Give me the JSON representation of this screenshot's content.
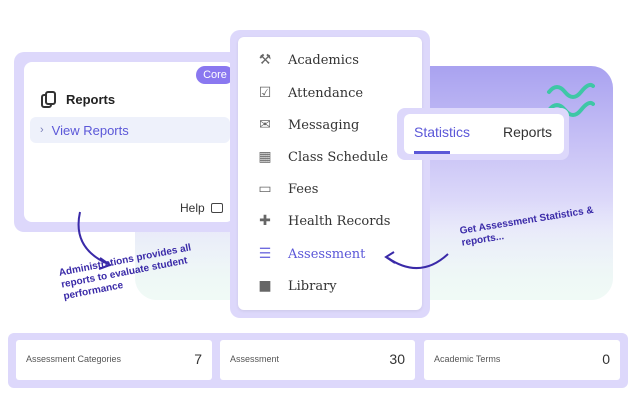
{
  "reports_card": {
    "badge": "Core",
    "title": "Reports",
    "view_reports": "View Reports",
    "help": "Help"
  },
  "menu": {
    "items": [
      {
        "label": "Academics",
        "icon": "wrench-icon"
      },
      {
        "label": "Attendance",
        "icon": "checkbox-icon"
      },
      {
        "label": "Messaging",
        "icon": "envelope-icon"
      },
      {
        "label": "Class Schedule",
        "icon": "calendar-icon"
      },
      {
        "label": "Fees",
        "icon": "cash-icon"
      },
      {
        "label": "Health Records",
        "icon": "health-plus-icon"
      },
      {
        "label": "Assessment",
        "icon": "document-icon"
      },
      {
        "label": "Library",
        "icon": "book-icon"
      }
    ],
    "active": "Assessment"
  },
  "tabs": {
    "statistics": "Statistics",
    "reports": "Reports",
    "active": "Statistics"
  },
  "notes": {
    "left": "Administrations provides all reports to evaluate student performance",
    "right": "Get Assessment Statistics & reports..."
  },
  "stats": [
    {
      "label": "Assessment Categories",
      "value": "7"
    },
    {
      "label": "Assessment",
      "value": "30"
    },
    {
      "label": "Academic Terms",
      "value": "0"
    }
  ],
  "colors": {
    "accent": "#5b57d8",
    "frame": "#ddd8fb",
    "badge": "#8a78f0",
    "wave": "#3ec7a6"
  }
}
